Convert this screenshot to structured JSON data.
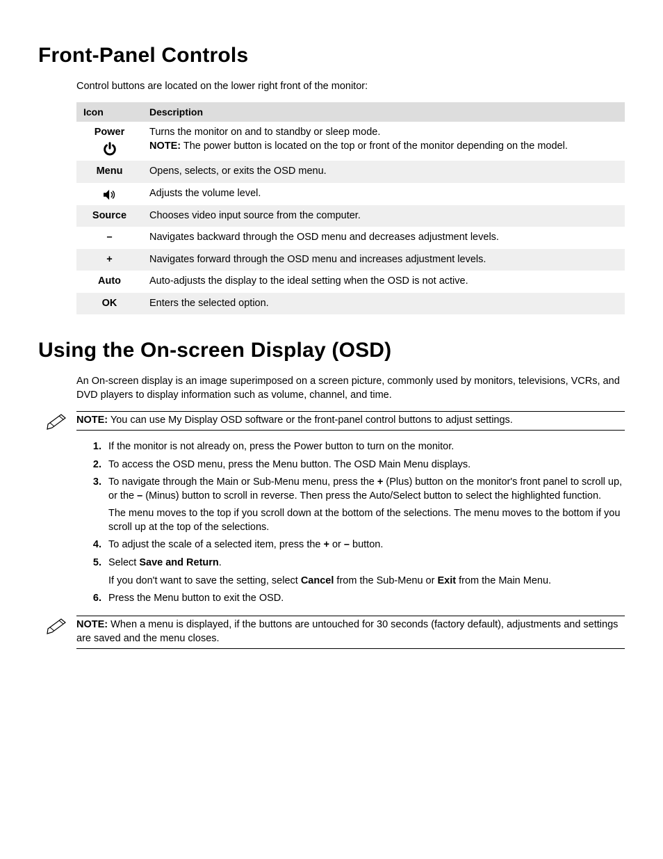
{
  "section1": {
    "heading": "Front-Panel Controls",
    "intro": "Control buttons are located on the lower right front of the monitor:",
    "table": {
      "headers": {
        "icon": "Icon",
        "desc": "Description"
      },
      "rows": [
        {
          "label": "Power",
          "desc": "Turns the monitor on and to standby or sleep mode.",
          "note_lead": "NOTE:",
          "note": " The power button is located on the top or front of the monitor depending on the model."
        },
        {
          "label": "Menu",
          "desc": "Opens, selects, or exits the OSD menu."
        },
        {
          "label": "",
          "desc": "Adjusts the volume level."
        },
        {
          "label": "Source",
          "desc": "Chooses video input source from the computer."
        },
        {
          "label": "–",
          "desc": "Navigates backward through the OSD menu and decreases adjustment levels."
        },
        {
          "label": "+",
          "desc": "Navigates forward through the OSD menu and increases adjustment levels."
        },
        {
          "label": "Auto",
          "desc": "Auto-adjusts the display to the ideal setting when the OSD is not active."
        },
        {
          "label": "OK",
          "desc": "Enters the selected option."
        }
      ]
    }
  },
  "section2": {
    "heading": "Using the On-screen Display (OSD)",
    "intro": "An On-screen display is an image superimposed on a screen picture, commonly used by monitors, televisions, VCRs, and DVD players to display information such as volume, channel, and time.",
    "note1_lead": "NOTE:",
    "note1_body": " You can use My Display OSD software or the front-panel control buttons to adjust settings.",
    "steps": {
      "s1": "If the monitor is not already on, press the Power button to turn on the monitor.",
      "s2": "To access the OSD menu, press the Menu button. The OSD Main Menu displays.",
      "s3a": "To navigate through the Main or Sub-Menu menu, press the ",
      "s3b_plus": "+",
      "s3c": " (Plus) button on the monitor's front panel to scroll up, or the ",
      "s3d_minus": "–",
      "s3e": " (Minus) button to scroll in reverse. Then press the Auto/Select button to select the highlighted function.",
      "s3_sub": "The menu moves to the top if you scroll down at the bottom of the selections. The menu moves to the bottom if you scroll up at the top of the selections.",
      "s4a": "To adjust the scale of a selected item, press the ",
      "s4b": "+",
      "s4c": " or ",
      "s4d": "–",
      "s4e": " button.",
      "s5a": "Select ",
      "s5b": "Save and Return",
      "s5c": ".",
      "s5_sub_a": "If you don't want to save the setting, select ",
      "s5_sub_b": "Cancel",
      "s5_sub_c": " from the Sub-Menu or ",
      "s5_sub_d": "Exit",
      "s5_sub_e": " from the Main Menu.",
      "s6": "Press the Menu button to exit the OSD."
    },
    "note2_lead": "NOTE:",
    "note2_body": " When a menu is displayed, if the buttons are untouched for 30 seconds (factory default), adjustments and settings are saved and the menu closes."
  }
}
